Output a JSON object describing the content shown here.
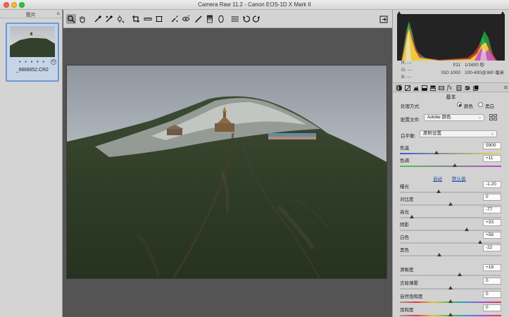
{
  "window": {
    "title": "Camera Raw 11.2 -  Canon EOS-1D X Mark II"
  },
  "filmstrip": {
    "title": "胶片",
    "thumbnail": {
      "rating": "• • • • •",
      "filename": "_8BI8652.CR2"
    }
  },
  "toolbar": {
    "tools": [
      "zoom-tool",
      "hand-tool",
      "white-balance-tool",
      "color-sampler-tool",
      "targeted-adjustment-tool",
      "crop-tool",
      "straighten-tool",
      "transform-tool",
      "spot-removal-tool",
      "red-eye-tool",
      "adjustment-brush-tool",
      "graduated-filter-tool",
      "radial-filter-tool",
      "preferences-icon",
      "rotate-left-icon",
      "rotate-right-icon"
    ],
    "active_tool": "zoom-tool"
  },
  "histogram": {
    "readout": {
      "r": "R:   ---",
      "g": "G:   ---",
      "b": "B:   ---"
    },
    "exif": {
      "aperture": "f/11",
      "shutter": "1/1600 秒",
      "iso": "ISO 1000",
      "lens": "100-400@380 毫米"
    }
  },
  "panel": {
    "section_title": "基本",
    "treatment": {
      "label": "处理方式:",
      "color_option": "颜色",
      "bw_option": "黑白",
      "selected": "颜色"
    },
    "profile": {
      "label": "配置文件:",
      "value": "Adobe 颜色"
    },
    "white_balance": {
      "label": "白平衡:",
      "value": "原照设置"
    },
    "auto_label": "自动",
    "default_label": "默认值",
    "colors": {
      "temp_gradient_start": "#3c5bd6",
      "temp_gradient_end": "#e7d84a",
      "tint_gradient_start": "#4dc34a",
      "tint_gradient_end": "#c049c4"
    },
    "sliders": {
      "temperature": {
        "label": "色温",
        "value": "5900",
        "fraction": 0.36
      },
      "tint": {
        "label": "色调",
        "value": "+11",
        "fraction": 0.54
      },
      "exposure": {
        "label": "曝光",
        "value": "-1.20",
        "fraction": 0.38
      },
      "contrast": {
        "label": "对比度",
        "value": "0",
        "fraction": 0.5
      },
      "highlights": {
        "label": "高光",
        "value": "-77",
        "fraction": 0.12
      },
      "shadows": {
        "label": "阴影",
        "value": "+33",
        "fraction": 0.66
      },
      "whites": {
        "label": "白色",
        "value": "+58",
        "fraction": 0.79
      },
      "blacks": {
        "label": "黑色",
        "value": "-22",
        "fraction": 0.39
      },
      "clarity": {
        "label": "清晰度",
        "value": "+18",
        "fraction": 0.59
      },
      "dehaze": {
        "label": "去除薄雾",
        "value": "0",
        "fraction": 0.5
      },
      "vibrance": {
        "label": "自然饱和度",
        "value": "0",
        "fraction": 0.5
      },
      "saturation": {
        "label": "饱和度",
        "value": "0",
        "fraction": 0.5
      }
    }
  }
}
